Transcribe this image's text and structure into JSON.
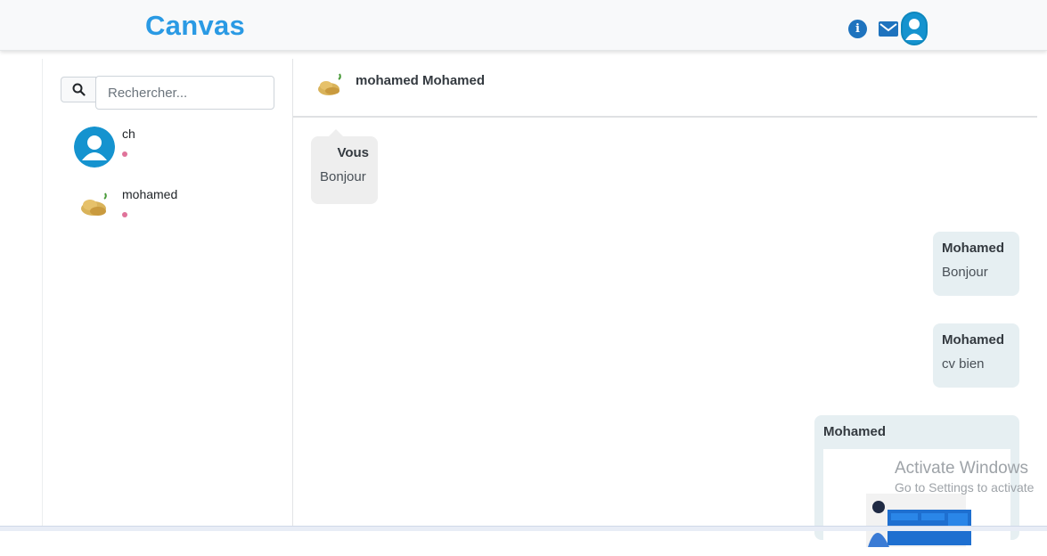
{
  "app": {
    "brand": "Canvas"
  },
  "navbar": {
    "icons": [
      "info-icon",
      "mail-icon",
      "user-avatar"
    ],
    "colors": {
      "brand": "#2a9ae4",
      "info": "#1e73be",
      "avatar": "#1593cf"
    }
  },
  "sidebar": {
    "search": {
      "placeholder": "Rechercher...",
      "value": ""
    },
    "contacts": [
      {
        "name": "ch",
        "status_color": "#e0739a",
        "avatar": "default-user-avatar"
      },
      {
        "name": "mohamed",
        "status_color": "#e0739a",
        "avatar": "bread-avatar"
      }
    ]
  },
  "chat": {
    "header": {
      "name": "mohamed Mohamed"
    },
    "messages": [
      {
        "sender": "Vous",
        "text": "Bonjour",
        "side": "left"
      },
      {
        "sender": "Mohamed",
        "text": "Bonjour",
        "side": "right"
      },
      {
        "sender": "Mohamed",
        "text": "cv bien",
        "side": "right"
      },
      {
        "sender": "Mohamed",
        "text": "",
        "side": "right",
        "attachment": "image"
      }
    ]
  },
  "watermark": {
    "line1": "Activate Windows",
    "line2": "Go to Settings to activate"
  }
}
